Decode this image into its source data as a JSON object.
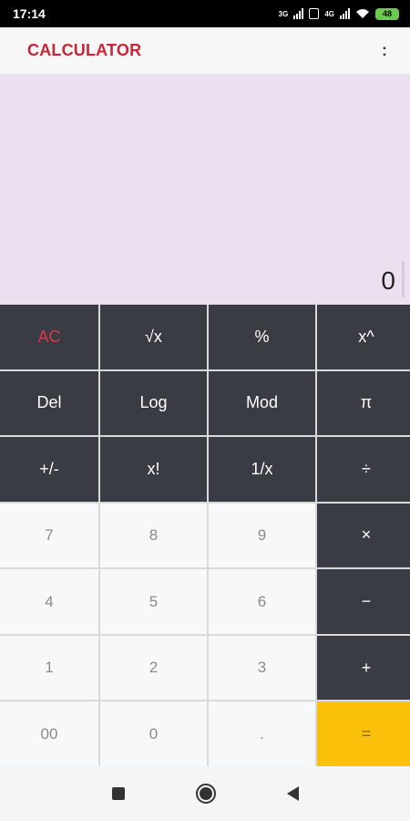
{
  "status_bar": {
    "time": "17:14",
    "network1": "3G",
    "network2": "4G",
    "battery": "48"
  },
  "app_bar": {
    "title": "CALCULATOR",
    "menu": ":"
  },
  "display": {
    "value": "0"
  },
  "keys": {
    "ac": "AC",
    "sqrt": "√x",
    "percent": "%",
    "power": "x^",
    "del": "Del",
    "log": "Log",
    "mod": "Mod",
    "pi": "π",
    "negate": "+/-",
    "factorial": "x!",
    "reciprocal": "1/x",
    "divide": "÷",
    "seven": "7",
    "eight": "8",
    "nine": "9",
    "multiply": "×",
    "four": "4",
    "five": "5",
    "six": "6",
    "minus": "−",
    "one": "1",
    "two": "2",
    "three": "3",
    "plus": "+",
    "double_zero": "00",
    "zero": "0",
    "decimal": ".",
    "equals": "="
  },
  "colors": {
    "accent": "#c8253a",
    "display_bg": "#ece0f0",
    "operator_key_bg": "#393c43",
    "equals_key_bg": "#fbc10a"
  }
}
